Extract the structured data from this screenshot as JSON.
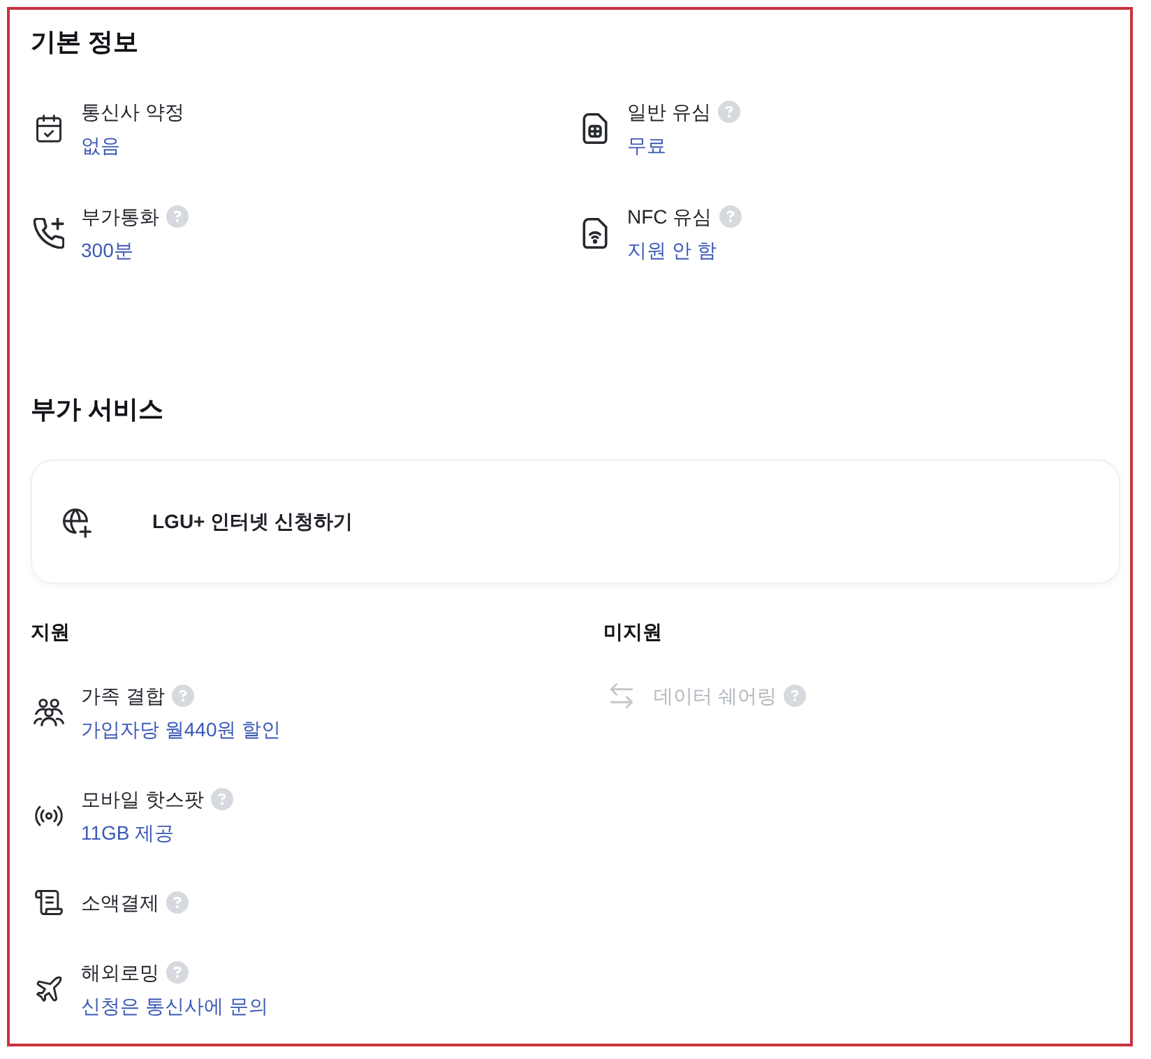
{
  "basic_info": {
    "title": "기본 정보",
    "items": [
      {
        "label": "통신사 약정",
        "value": "없음",
        "help": false
      },
      {
        "label": "일반 유심",
        "value": "무료",
        "help": true
      },
      {
        "label": "부가통화",
        "value": "300분",
        "help": true
      },
      {
        "label": "NFC 유심",
        "value": "지원 안 함",
        "help": true
      }
    ]
  },
  "extra_services": {
    "title": "부가 서비스",
    "internet_card": {
      "label": "LGU+ 인터넷 신청하기"
    },
    "supported": {
      "title": "지원",
      "items": [
        {
          "label": "가족 결합",
          "value": "가입자당 월440원 할인",
          "help": true,
          "disabled": false
        },
        {
          "label": "모바일 핫스팟",
          "value": "11GB 제공",
          "help": true,
          "disabled": false
        },
        {
          "label": "소액결제",
          "help": true,
          "disabled": false
        },
        {
          "label": "해외로밍",
          "value": "신청은 통신사에 문의",
          "help": true,
          "disabled": false
        }
      ]
    },
    "unsupported": {
      "title": "미지원",
      "items": [
        {
          "label": "데이터 쉐어링",
          "help": true,
          "disabled": true
        }
      ]
    }
  }
}
